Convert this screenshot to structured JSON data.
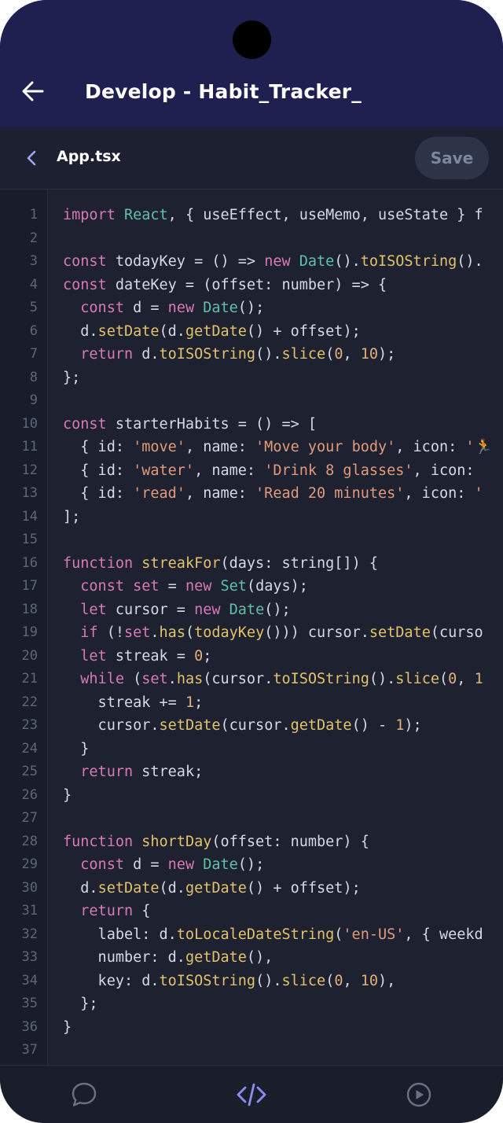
{
  "appbar": {
    "title": "Develop - Habit_Tracker_"
  },
  "filebar": {
    "file_name": "App.tsx",
    "save_label": "Save"
  },
  "colors": {
    "header_bg": "#1f1f50",
    "editor_bg": "#1d2130",
    "keyword": "#d97ab8",
    "type": "#5fc2a6",
    "function": "#e2c36b",
    "string": "#e39a7b",
    "number": "#e3b07a",
    "plain": "#d7dae3",
    "nav_active": "#8a8df0",
    "nav_inactive": "#6b7185"
  },
  "nav": [
    {
      "icon": "chat-icon",
      "active": false
    },
    {
      "icon": "code-icon",
      "active": true
    },
    {
      "icon": "play-icon",
      "active": false
    }
  ],
  "line_numbers": [
    "1",
    "2",
    "3",
    "4",
    "5",
    "6",
    "7",
    "8",
    "9",
    "10",
    "11",
    "12",
    "13",
    "14",
    "15",
    "16",
    "17",
    "18",
    "19",
    "20",
    "21",
    "22",
    "23",
    "24",
    "25",
    "26",
    "27",
    "28",
    "29",
    "30",
    "31",
    "32",
    "33",
    "34",
    "35",
    "36",
    "37"
  ],
  "code_lines": [
    [
      [
        "kw",
        "import "
      ],
      [
        "ty",
        "React"
      ],
      [
        "p",
        ", { useEffect, useMemo, useState } f"
      ]
    ],
    [],
    [
      [
        "kw",
        "const "
      ],
      [
        "p",
        "todayKey = () => "
      ],
      [
        "kw",
        "new "
      ],
      [
        "ty",
        "Date"
      ],
      [
        "p",
        "()."
      ],
      [
        "fn",
        "toISOString"
      ],
      [
        "p",
        "()."
      ]
    ],
    [
      [
        "kw",
        "const "
      ],
      [
        "p",
        "dateKey = (offset: number) => {"
      ]
    ],
    [
      [
        "p",
        "  "
      ],
      [
        "kw",
        "const "
      ],
      [
        "p",
        "d = "
      ],
      [
        "kw",
        "new "
      ],
      [
        "ty",
        "Date"
      ],
      [
        "p",
        "();"
      ]
    ],
    [
      [
        "p",
        "  d."
      ],
      [
        "fn",
        "setDate"
      ],
      [
        "p",
        "(d."
      ],
      [
        "fn",
        "getDate"
      ],
      [
        "p",
        "() + offset);"
      ]
    ],
    [
      [
        "p",
        "  "
      ],
      [
        "kw",
        "return "
      ],
      [
        "p",
        "d."
      ],
      [
        "fn",
        "toISOString"
      ],
      [
        "p",
        "()."
      ],
      [
        "fn",
        "slice"
      ],
      [
        "p",
        "("
      ],
      [
        "num",
        "0"
      ],
      [
        "p",
        ", "
      ],
      [
        "num",
        "10"
      ],
      [
        "p",
        ");"
      ]
    ],
    [
      [
        "p",
        "};"
      ]
    ],
    [],
    [
      [
        "kw",
        "const "
      ],
      [
        "p",
        "starterHabits = () => ["
      ]
    ],
    [
      [
        "p",
        "  { id: "
      ],
      [
        "str",
        "'move'"
      ],
      [
        "p",
        ", name: "
      ],
      [
        "str",
        "'Move your body'"
      ],
      [
        "p",
        ", icon: "
      ],
      [
        "str",
        "'🏃"
      ]
    ],
    [
      [
        "p",
        "  { id: "
      ],
      [
        "str",
        "'water'"
      ],
      [
        "p",
        ", name: "
      ],
      [
        "str",
        "'Drink 8 glasses'"
      ],
      [
        "p",
        ", icon: "
      ]
    ],
    [
      [
        "p",
        "  { id: "
      ],
      [
        "str",
        "'read'"
      ],
      [
        "p",
        ", name: "
      ],
      [
        "str",
        "'Read 20 minutes'"
      ],
      [
        "p",
        ", icon: "
      ],
      [
        "str",
        "'"
      ]
    ],
    [
      [
        "p",
        "];"
      ]
    ],
    [],
    [
      [
        "kw",
        "function "
      ],
      [
        "fn",
        "streakFor"
      ],
      [
        "p",
        "(days: string[]) {"
      ]
    ],
    [
      [
        "p",
        "  "
      ],
      [
        "kw",
        "const set "
      ],
      [
        "p",
        "= "
      ],
      [
        "kw",
        "new "
      ],
      [
        "ty",
        "Set"
      ],
      [
        "p",
        "(days);"
      ]
    ],
    [
      [
        "p",
        "  "
      ],
      [
        "kw",
        "let "
      ],
      [
        "p",
        "cursor = "
      ],
      [
        "kw",
        "new "
      ],
      [
        "ty",
        "Date"
      ],
      [
        "p",
        "();"
      ]
    ],
    [
      [
        "p",
        "  "
      ],
      [
        "kw",
        "if "
      ],
      [
        "p",
        "(!"
      ],
      [
        "kw",
        "set"
      ],
      [
        "p",
        "."
      ],
      [
        "fn",
        "has"
      ],
      [
        "p",
        "("
      ],
      [
        "fn",
        "todayKey"
      ],
      [
        "p",
        "())) cursor."
      ],
      [
        "fn",
        "setDate"
      ],
      [
        "p",
        "(curso"
      ]
    ],
    [
      [
        "p",
        "  "
      ],
      [
        "kw",
        "let "
      ],
      [
        "p",
        "streak = "
      ],
      [
        "num",
        "0"
      ],
      [
        "p",
        ";"
      ]
    ],
    [
      [
        "p",
        "  "
      ],
      [
        "kw",
        "while "
      ],
      [
        "p",
        "("
      ],
      [
        "kw",
        "set"
      ],
      [
        "p",
        "."
      ],
      [
        "fn",
        "has"
      ],
      [
        "p",
        "(cursor."
      ],
      [
        "fn",
        "toISOString"
      ],
      [
        "p",
        "()."
      ],
      [
        "fn",
        "slice"
      ],
      [
        "p",
        "("
      ],
      [
        "num",
        "0"
      ],
      [
        "p",
        ", "
      ],
      [
        "num",
        "1"
      ]
    ],
    [
      [
        "p",
        "    streak += "
      ],
      [
        "num",
        "1"
      ],
      [
        "p",
        ";"
      ]
    ],
    [
      [
        "p",
        "    cursor."
      ],
      [
        "fn",
        "setDate"
      ],
      [
        "p",
        "(cursor."
      ],
      [
        "fn",
        "getDate"
      ],
      [
        "p",
        "() - "
      ],
      [
        "num",
        "1"
      ],
      [
        "p",
        ");"
      ]
    ],
    [
      [
        "p",
        "  }"
      ]
    ],
    [
      [
        "p",
        "  "
      ],
      [
        "kw",
        "return "
      ],
      [
        "p",
        "streak;"
      ]
    ],
    [
      [
        "p",
        "}"
      ]
    ],
    [],
    [
      [
        "kw",
        "function "
      ],
      [
        "fn",
        "shortDay"
      ],
      [
        "p",
        "(offset: number) {"
      ]
    ],
    [
      [
        "p",
        "  "
      ],
      [
        "kw",
        "const "
      ],
      [
        "p",
        "d = "
      ],
      [
        "kw",
        "new "
      ],
      [
        "ty",
        "Date"
      ],
      [
        "p",
        "();"
      ]
    ],
    [
      [
        "p",
        "  d."
      ],
      [
        "fn",
        "setDate"
      ],
      [
        "p",
        "(d."
      ],
      [
        "fn",
        "getDate"
      ],
      [
        "p",
        "() + offset);"
      ]
    ],
    [
      [
        "p",
        "  "
      ],
      [
        "kw",
        "return "
      ],
      [
        "p",
        "{"
      ]
    ],
    [
      [
        "p",
        "    label: d."
      ],
      [
        "fn",
        "toLocaleDateString"
      ],
      [
        "p",
        "("
      ],
      [
        "str",
        "'en-US'"
      ],
      [
        "p",
        ", { weekd"
      ]
    ],
    [
      [
        "p",
        "    number: d."
      ],
      [
        "fn",
        "getDate"
      ],
      [
        "p",
        "(),"
      ]
    ],
    [
      [
        "p",
        "    key: d."
      ],
      [
        "fn",
        "toISOString"
      ],
      [
        "p",
        "()."
      ],
      [
        "fn",
        "slice"
      ],
      [
        "p",
        "("
      ],
      [
        "num",
        "0"
      ],
      [
        "p",
        ", "
      ],
      [
        "num",
        "10"
      ],
      [
        "p",
        "),"
      ]
    ],
    [
      [
        "p",
        "  };"
      ]
    ],
    [
      [
        "p",
        "}"
      ]
    ],
    []
  ]
}
